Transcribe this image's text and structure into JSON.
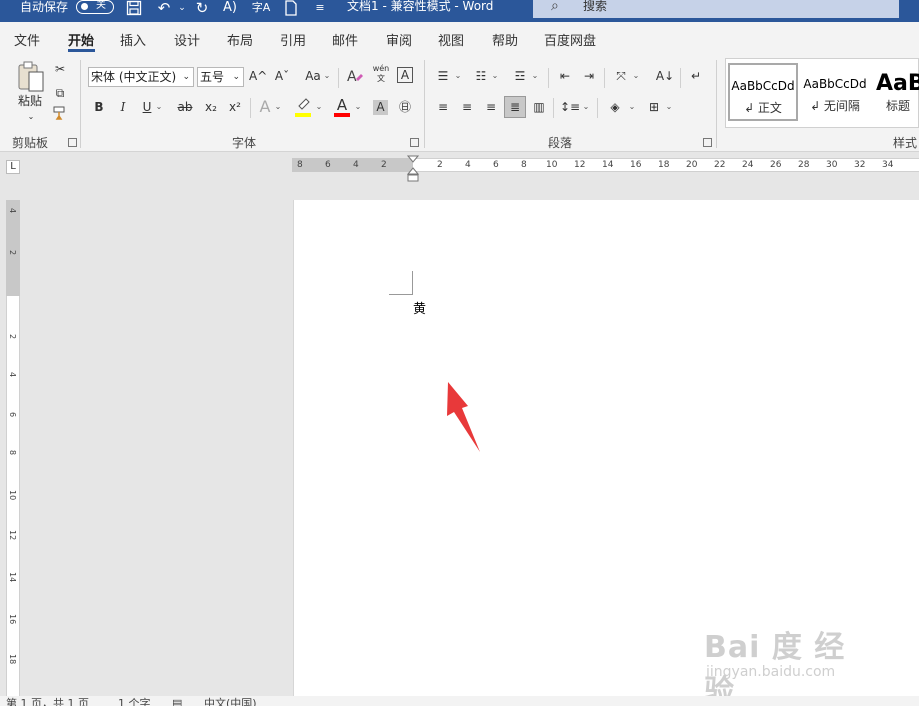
{
  "titlebar": {
    "autosave_label": "自动保存",
    "autosave_state": "关",
    "doc_title": "文档1  -  兼容性模式  -  Word",
    "search_placeholder": "搜索",
    "color": "#2b579a"
  },
  "tabs": [
    "文件",
    "开始",
    "插入",
    "设计",
    "布局",
    "引用",
    "邮件",
    "审阅",
    "视图",
    "帮助",
    "百度网盘"
  ],
  "active_tab": "开始",
  "ribbon": {
    "clipboard": {
      "paste_label": "粘贴",
      "group_label": "剪贴板"
    },
    "font": {
      "font_name": "宋体 (中文正文)",
      "font_size": "五号",
      "grow": "A^",
      "shrink": "Aˇ",
      "change_case": "Aa",
      "bold": "B",
      "italic": "I",
      "underline": "U",
      "strike": "ab",
      "subscript": "x₂",
      "superscript": "x²",
      "phonetic": "wén 文",
      "group_label": "字体",
      "highlight_color": "#ffff00",
      "font_color": "#ff0000"
    },
    "paragraph": {
      "group_label": "段落"
    },
    "styles": {
      "items": [
        {
          "sample": "AaBbCcDd",
          "name": "↲ 正文"
        },
        {
          "sample": "AaBbCcDd",
          "name": "↲ 无间隔"
        },
        {
          "sample": "AaB",
          "name": "标题"
        }
      ],
      "group_label": "样式"
    }
  },
  "ruler": {
    "h_left": [
      "8",
      "6",
      "4",
      "2"
    ],
    "h_right": [
      "2",
      "4",
      "6",
      "8",
      "10",
      "12",
      "14",
      "16",
      "18",
      "20",
      "22",
      "24",
      "26",
      "28",
      "30",
      "32",
      "34"
    ],
    "v_top": [
      "4",
      "2"
    ],
    "v_bottom": [
      "2",
      "4",
      "6",
      "8",
      "10",
      "12",
      "14",
      "16",
      "18"
    ],
    "tab_selector": "L"
  },
  "document": {
    "text": "黄"
  },
  "watermark": {
    "brand": "Bai 度 经验",
    "url": "jingyan.baidu.com"
  },
  "statusbar": {
    "page": "第 1 页，共 1 页",
    "words": "1 个字",
    "language": "中文(中国)"
  }
}
